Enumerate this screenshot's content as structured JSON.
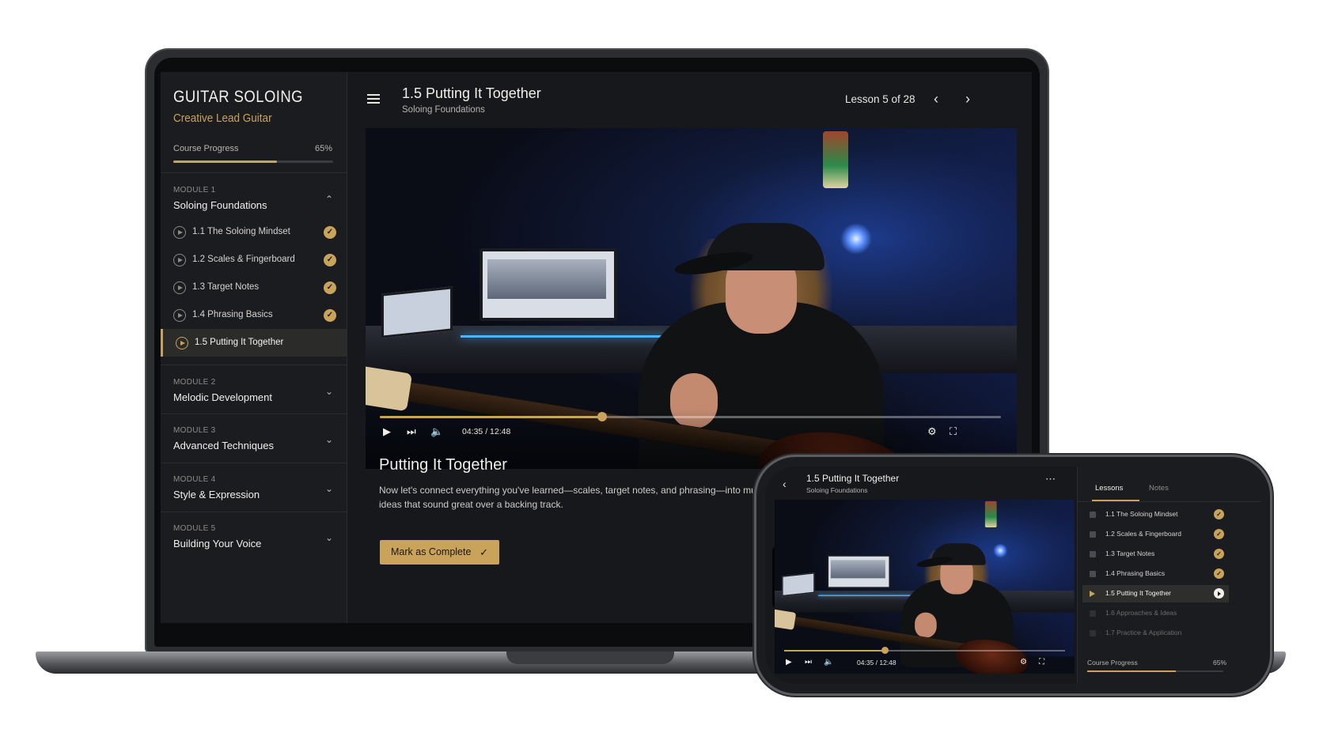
{
  "colors": {
    "accent": "#c9a35a",
    "background": "#16181c",
    "sidebar": "#1a1c20",
    "text": "#f1efe9"
  },
  "course": {
    "title": "GUITAR SOLOING",
    "subtitle": "Creative Lead Guitar",
    "progress_label": "Course Progress",
    "progress_value": "65%",
    "progress_fraction": 0.65
  },
  "modules": [
    {
      "number": "MODULE 1",
      "title": "Soloing Foundations",
      "expanded": true,
      "icon": "chevron-up-icon"
    },
    {
      "number": "MODULE 2",
      "title": "Melodic Development",
      "expanded": false,
      "icon": "chevron-down-icon"
    },
    {
      "number": "MODULE 3",
      "title": "Advanced Techniques",
      "expanded": false,
      "icon": "chevron-down-icon"
    },
    {
      "number": "MODULE 4",
      "title": "Style & Expression",
      "expanded": false,
      "icon": "chevron-down-icon"
    },
    {
      "number": "MODULE 5",
      "title": "Building Your Voice",
      "expanded": false,
      "icon": "chevron-down-icon"
    }
  ],
  "lessons": [
    {
      "label": "1.1  The Soloing Mindset",
      "status": "complete"
    },
    {
      "label": "1.2  Scales & Fingerboard",
      "status": "complete"
    },
    {
      "label": "1.3  Target Notes",
      "status": "complete"
    },
    {
      "label": "1.4  Phrasing Basics",
      "status": "complete"
    },
    {
      "label": "1.5  Putting It Together",
      "status": "current"
    }
  ],
  "header": {
    "title": "1.5 Putting It Together",
    "module": "Soloing Foundations",
    "lesson_count": "Lesson 5 of 28",
    "prev_icon": "chevron-left-icon",
    "next_icon": "chevron-right-icon",
    "menu_icon": "hamburger-icon"
  },
  "player": {
    "time": "04:35 / 12:48",
    "played_fraction": 0.358,
    "icons": [
      "play-icon",
      "skip-next-icon",
      "volume-icon",
      "settings-icon",
      "fullscreen-icon"
    ]
  },
  "lesson_body": {
    "heading": "Putting It Together",
    "description": "Now let's connect everything you've learned—scales, target notes, and phrasing—into musical ideas that sound great over a backing track.",
    "button_label": "Mark as Complete",
    "button_icon": "check-icon"
  },
  "mobile": {
    "title": "1.5 Putting It Together",
    "module": "Soloing Foundations",
    "more_icon": "more-horizontal-icon",
    "back_icon": "chevron-left-icon",
    "tabs": [
      "Lessons",
      "Notes"
    ],
    "active_tab": "Lessons",
    "time": "04:35 / 12:48",
    "lessons": [
      {
        "label": "1.1 The Soloing Mindset",
        "status": "complete"
      },
      {
        "label": "1.2 Scales & Fingerboard",
        "status": "complete"
      },
      {
        "label": "1.3 Target Notes",
        "status": "complete"
      },
      {
        "label": "1.4 Phrasing Basics",
        "status": "complete"
      },
      {
        "label": "1.5 Putting It Together",
        "status": "current"
      },
      {
        "label": "1.6 Approaches & Ideas",
        "status": "locked"
      },
      {
        "label": "1.7 Practice & Application",
        "status": "locked"
      }
    ],
    "progress_label": "Course Progress",
    "progress_value": "65%"
  }
}
